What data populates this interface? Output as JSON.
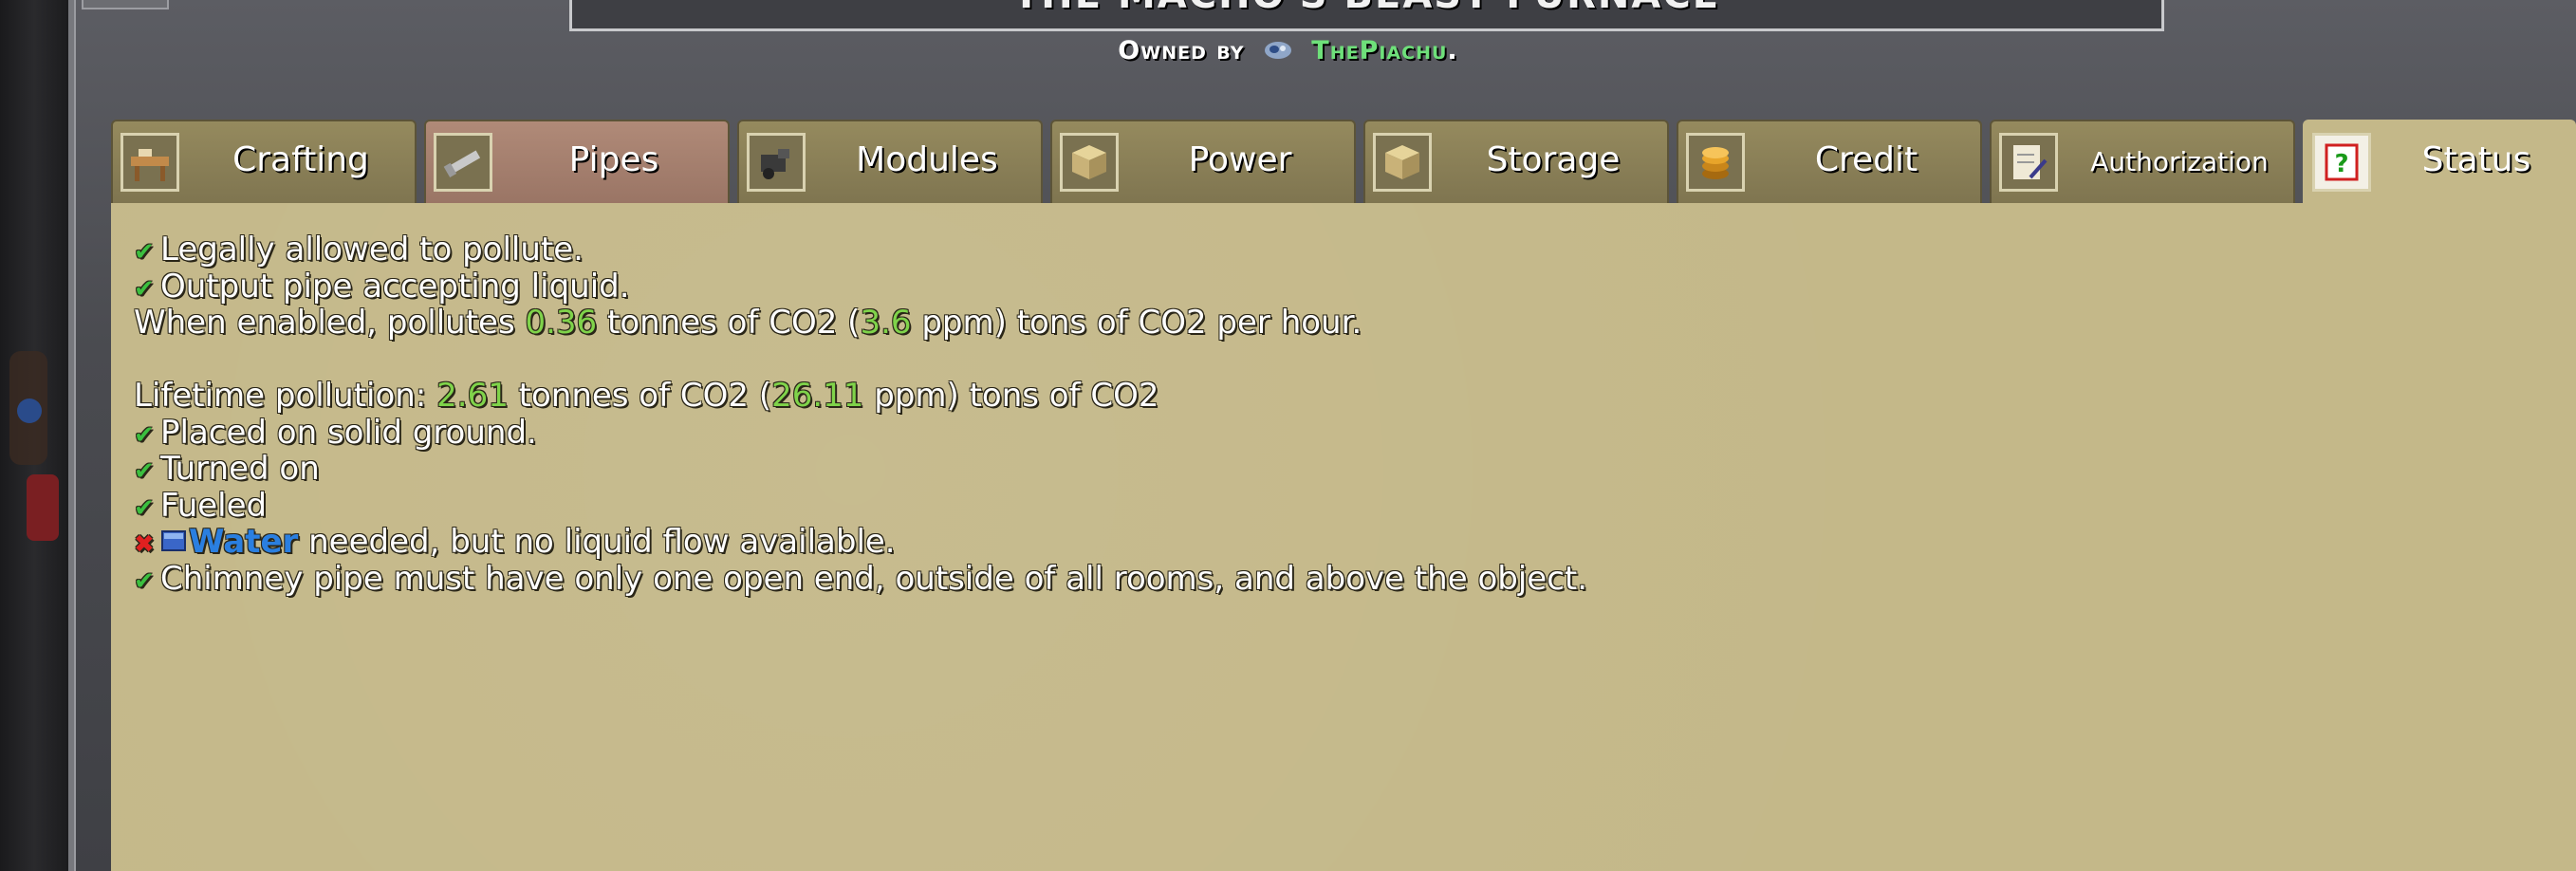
{
  "window": {
    "title": "THE MACHO'S BEAST FURNACE",
    "owner_label": "Owned by",
    "owner_name": "ThePiachu",
    "owner_suffix": "."
  },
  "tabs": [
    {
      "label": "Crafting",
      "icon": "crafting-table-icon",
      "active": false
    },
    {
      "label": "Pipes",
      "icon": "pipe-icon",
      "active": true
    },
    {
      "label": "Modules",
      "icon": "modules-icon",
      "active": false
    },
    {
      "label": "Power",
      "icon": "crate-icon",
      "active": false
    },
    {
      "label": "Storage",
      "icon": "crate-icon",
      "active": false
    },
    {
      "label": "Credit",
      "icon": "coins-icon",
      "active": false
    },
    {
      "label": "Authorization",
      "icon": "document-pen-icon",
      "active": false
    },
    {
      "label": "Status",
      "icon": "question-mark-icon",
      "active": false,
      "selected": true
    }
  ],
  "status": {
    "check_ok": "✔",
    "check_bad": "✖",
    "line1": "Legally allowed to pollute.",
    "line2": "Output pipe accepting liquid.",
    "pollution_prefix": "When enabled, pollutes ",
    "pollution_rate": "0.36",
    "pollution_mid": " tonnes of CO2 (",
    "pollution_ppm": "3.6",
    "pollution_suffix": " ppm) tons of CO2 per hour.",
    "lifetime_prefix": "Lifetime pollution: ",
    "lifetime_tonnes": "2.61",
    "lifetime_mid": " tonnes of CO2 (",
    "lifetime_ppm": "26.11",
    "lifetime_suffix": " ppm) tons of CO2",
    "line_ground": "Placed on solid ground.",
    "line_turned_on": "Turned on",
    "line_fueled": "Fueled",
    "water_word": "Water",
    "water_rest": " needed, but no liquid flow available.",
    "line_chimney": "Chimney pipe must have only one open end, outside of all rooms, and above the object."
  },
  "colors": {
    "panel": "#c4b889",
    "ok_check": "#3bbf3f",
    "bad_x": "#e02020",
    "value_green": "#7fd34a",
    "water_blue": "#2a7fe0",
    "owner_green": "#6ee07a"
  }
}
